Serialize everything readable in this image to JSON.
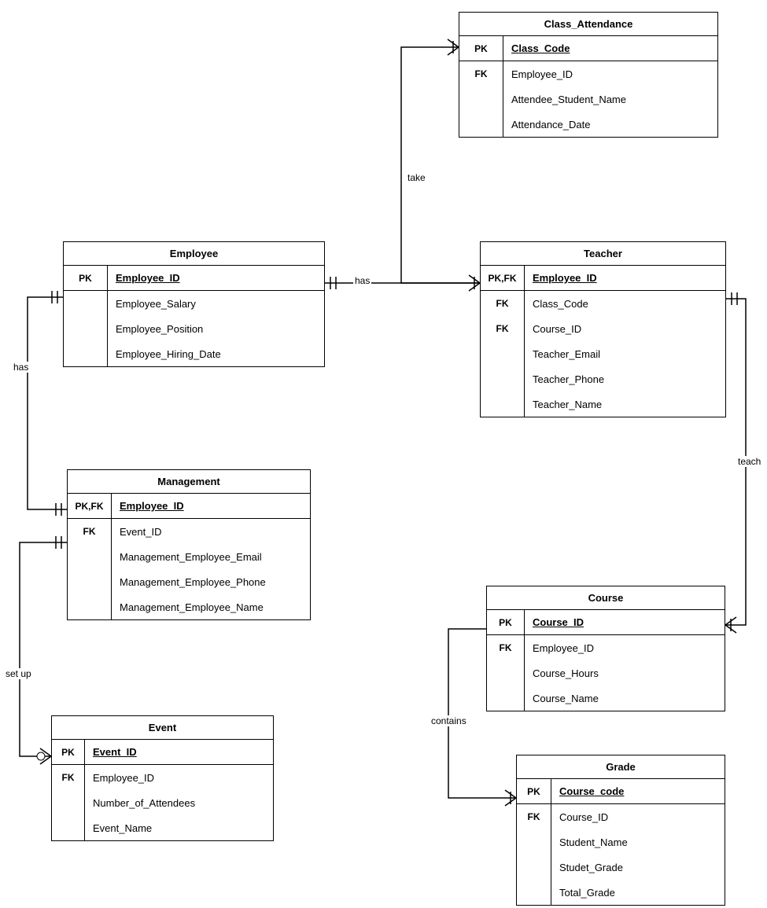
{
  "chart_data": {
    "type": "er-diagram",
    "entities": [
      {
        "id": "class_attendance",
        "title": "Class_Attendance",
        "attrs": [
          {
            "key": "PK",
            "name": "Class_Code",
            "u": true,
            "sep": true
          },
          {
            "key": "FK",
            "name": "Employee_ID"
          },
          {
            "key": "",
            "name": "Attendee_Student_Name"
          },
          {
            "key": "",
            "name": "Attendance_Date"
          }
        ]
      },
      {
        "id": "employee",
        "title": "Employee",
        "attrs": [
          {
            "key": "PK",
            "name": "Employee_ID",
            "u": true,
            "sep": true
          },
          {
            "key": "",
            "name": "Employee_Salary"
          },
          {
            "key": "",
            "name": "Employee_Position"
          },
          {
            "key": "",
            "name": "Employee_Hiring_Date"
          }
        ]
      },
      {
        "id": "teacher",
        "title": "Teacher",
        "attrs": [
          {
            "key": "PK,FK",
            "name": "Employee_ID",
            "u": true,
            "sep": true
          },
          {
            "key": "FK",
            "name": "Class_Code"
          },
          {
            "key": "FK",
            "name": "Course_ID"
          },
          {
            "key": "",
            "name": "Teacher_Email"
          },
          {
            "key": "",
            "name": "Teacher_Phone"
          },
          {
            "key": "",
            "name": "Teacher_Name"
          }
        ]
      },
      {
        "id": "management",
        "title": "Management",
        "attrs": [
          {
            "key": "PK,FK",
            "name": "Employee_ID",
            "u": true,
            "sep": true
          },
          {
            "key": "FK",
            "name": "Event_ID"
          },
          {
            "key": "",
            "name": "Management_Employee_Email"
          },
          {
            "key": "",
            "name": "Management_Employee_Phone"
          },
          {
            "key": "",
            "name": "Management_Employee_Name"
          }
        ]
      },
      {
        "id": "event",
        "title": "Event",
        "attrs": [
          {
            "key": "PK",
            "name": "Event_ID",
            "u": true,
            "sep": true
          },
          {
            "key": "FK",
            "name": "Employee_ID"
          },
          {
            "key": "",
            "name": "Number_of_Attendees"
          },
          {
            "key": "",
            "name": "Event_Name"
          }
        ]
      },
      {
        "id": "course",
        "title": "Course",
        "attrs": [
          {
            "key": "PK",
            "name": "Course_ID",
            "u": true,
            "sep": true
          },
          {
            "key": "FK",
            "name": "Employee_ID"
          },
          {
            "key": "",
            "name": "Course_Hours"
          },
          {
            "key": "",
            "name": "Course_Name"
          }
        ]
      },
      {
        "id": "grade",
        "title": "Grade",
        "attrs": [
          {
            "key": "PK",
            "name": "Course_code",
            "u": true,
            "sep": true
          },
          {
            "key": "FK",
            "name": "Course_ID"
          },
          {
            "key": "",
            "name": "Student_Name"
          },
          {
            "key": "",
            "name": "Studet_Grade"
          },
          {
            "key": "",
            "name": "Total_Grade"
          }
        ]
      }
    ],
    "relationships": [
      {
        "from": "Teacher",
        "to": "Class_Attendance",
        "label": "take"
      },
      {
        "from": "Employee",
        "to": "Teacher",
        "label": "has"
      },
      {
        "from": "Employee",
        "to": "Management",
        "label": "has"
      },
      {
        "from": "Management",
        "to": "Event",
        "label": "set up"
      },
      {
        "from": "Teacher",
        "to": "Course",
        "label": "teach"
      },
      {
        "from": "Course",
        "to": "Grade",
        "label": "contains"
      }
    ]
  },
  "labels": {
    "take": "take",
    "has1": "has",
    "has2": "has",
    "setup": "set up",
    "teach": "teach",
    "contains": "contains"
  },
  "entities": {
    "class_attendance": {
      "title": "Class_Attendance",
      "keys": [
        "PK",
        "FK",
        "",
        ""
      ],
      "names": [
        "Class_Code",
        "Employee_ID",
        "Attendee_Student_Name",
        "Attendance_Date"
      ]
    },
    "employee": {
      "title": "Employee",
      "keys": [
        "PK",
        "",
        "",
        ""
      ],
      "names": [
        "Employee_ID",
        "Employee_Salary",
        "Employee_Position",
        "Employee_Hiring_Date"
      ]
    },
    "teacher": {
      "title": "Teacher",
      "keys": [
        "PK,FK",
        "FK",
        "FK",
        "",
        "",
        ""
      ],
      "names": [
        "Employee_ID",
        "Class_Code",
        "Course_ID",
        "Teacher_Email",
        "Teacher_Phone",
        "Teacher_Name"
      ]
    },
    "management": {
      "title": "Management",
      "keys": [
        "PK,FK",
        "FK",
        "",
        "",
        ""
      ],
      "names": [
        "Employee_ID",
        "Event_ID",
        "Management_Employee_Email",
        "Management_Employee_Phone",
        "Management_Employee_Name"
      ]
    },
    "event": {
      "title": "Event",
      "keys": [
        "PK",
        "FK",
        "",
        ""
      ],
      "names": [
        "Event_ID",
        "Employee_ID",
        "Number_of_Attendees",
        "Event_Name"
      ]
    },
    "course": {
      "title": "Course",
      "keys": [
        "PK",
        "FK",
        "",
        ""
      ],
      "names": [
        "Course_ID",
        "Employee_ID",
        "Course_Hours",
        "Course_Name"
      ]
    },
    "grade": {
      "title": "Grade",
      "keys": [
        "PK",
        "FK",
        "",
        "",
        ""
      ],
      "names": [
        "Course_code",
        "Course_ID",
        "Student_Name",
        "Studet_Grade",
        "Total_Grade"
      ]
    }
  }
}
